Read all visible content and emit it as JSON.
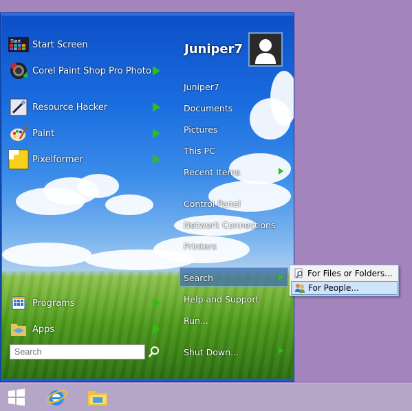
{
  "start_menu": {
    "user_name": "Juniper7",
    "left_items": [
      {
        "label": "Start Screen",
        "icon": "start-screen-icon",
        "has_arrow": false
      },
      {
        "label": "Corel Paint Shop Pro Photo",
        "icon": "paintshop-icon",
        "has_arrow": true
      },
      {
        "label": "Resource Hacker",
        "icon": "resource-hacker-icon",
        "has_arrow": true
      },
      {
        "label": "Paint",
        "icon": "paint-palette-icon",
        "has_arrow": true
      },
      {
        "label": "Pixelformer",
        "icon": "pixelformer-icon",
        "has_arrow": true
      }
    ],
    "start_icon_text": "Start",
    "bottom_items": [
      {
        "label": "Programs",
        "icon": "programs-icon",
        "has_arrow": true
      },
      {
        "label": "Apps",
        "icon": "apps-icon",
        "has_arrow": true
      }
    ],
    "search_placeholder": "Search",
    "right_items": [
      {
        "label": "Juniper7",
        "has_arrow": false
      },
      {
        "label": "Documents",
        "has_arrow": false
      },
      {
        "label": "Pictures",
        "has_arrow": false
      },
      {
        "label": "This PC",
        "has_arrow": false
      },
      {
        "label": "Recent Items",
        "has_arrow": true
      },
      {
        "label": "Control Panel",
        "has_arrow": false
      },
      {
        "label": "Network Connections",
        "has_arrow": false
      },
      {
        "label": "Printers",
        "has_arrow": false
      },
      {
        "label": "Search",
        "has_arrow": true
      },
      {
        "label": "Help and Support",
        "has_arrow": false
      },
      {
        "label": "Run...",
        "has_arrow": false
      },
      {
        "label": "Shut Down...",
        "has_arrow": true
      }
    ]
  },
  "search_submenu": {
    "items": [
      {
        "label": "For Files or Folders...",
        "icon": "search-files-icon",
        "selected": false
      },
      {
        "label": "For People...",
        "icon": "people-icon",
        "selected": true
      }
    ]
  },
  "taskbar": {
    "buttons": [
      {
        "name": "windows-start-icon"
      },
      {
        "name": "internet-explorer-icon"
      },
      {
        "name": "file-explorer-icon"
      }
    ]
  },
  "colors": {
    "desktop": "#a384bd",
    "menu_frame": "#1e5fd0",
    "arrow": "#2fbf12",
    "taskbar": "#b5a6c8"
  }
}
